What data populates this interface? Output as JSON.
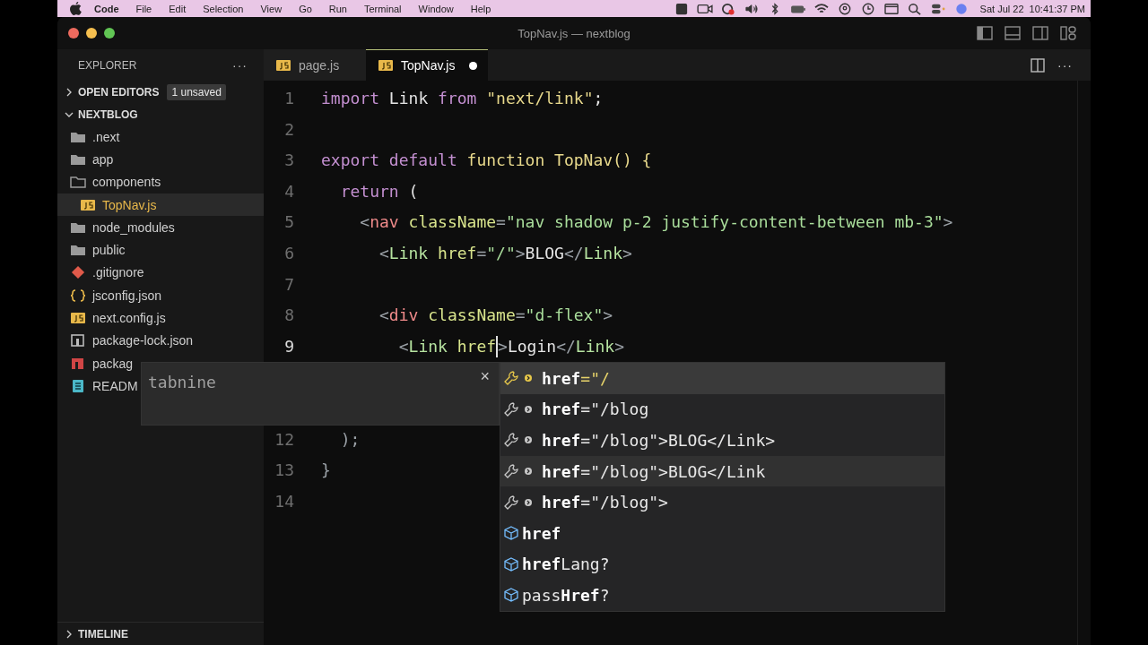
{
  "menubar": {
    "app": "Code",
    "items": [
      "File",
      "Edit",
      "Selection",
      "View",
      "Go",
      "Run",
      "Terminal",
      "Window",
      "Help"
    ],
    "clock": "Sat Jul 22  10:41:37 PM"
  },
  "window": {
    "title": "TopNav.js — nextblog"
  },
  "sidebar": {
    "title": "EXPLORER",
    "more": "···",
    "open_editors": {
      "label": "OPEN EDITORS",
      "expanded": false,
      "badge": "1 unsaved"
    },
    "project": {
      "label": "NEXTBLOG",
      "expanded": true,
      "items": [
        {
          "name": ".next",
          "kind": "folder",
          "expanded": false,
          "selected": false
        },
        {
          "name": "app",
          "kind": "folder",
          "expanded": false,
          "selected": false
        },
        {
          "name": "components",
          "kind": "folder",
          "expanded": true,
          "selected": false,
          "children": [
            {
              "name": "TopNav.js",
              "kind": "js",
              "selected": true
            }
          ]
        },
        {
          "name": "node_modules",
          "kind": "folder",
          "expanded": false,
          "selected": false
        },
        {
          "name": "public",
          "kind": "folder",
          "expanded": false,
          "selected": false
        },
        {
          "name": ".gitignore",
          "kind": "git",
          "selected": false
        },
        {
          "name": "jsconfig.json",
          "kind": "json",
          "selected": false
        },
        {
          "name": "next.config.js",
          "kind": "js",
          "selected": false
        },
        {
          "name": "package-lock.json",
          "kind": "lock",
          "selected": false
        },
        {
          "name": "packag",
          "kind": "pkg",
          "selected": false
        },
        {
          "name": "READM",
          "kind": "readme",
          "selected": false
        }
      ]
    },
    "timeline": {
      "label": "TIMELINE",
      "expanded": false
    }
  },
  "tabs": [
    {
      "label": "page.js",
      "selected": false,
      "dirty": false
    },
    {
      "label": "TopNav.js",
      "selected": true,
      "dirty": true
    }
  ],
  "editor_more": "···",
  "lines": [
    {
      "number": "1",
      "tokens": [
        {
          "kind": "kw",
          "t": "import"
        },
        {
          "kind": "plain",
          "t": " Link "
        },
        {
          "kind": "kw",
          "t": "from"
        },
        {
          "kind": "str",
          "t": " \"next/link\""
        },
        {
          "kind": "plain",
          "t": ";"
        }
      ]
    },
    {
      "number": "2"
    },
    {
      "number": "3",
      "tokens": [
        {
          "kind": "kw",
          "t": "export default"
        },
        {
          "kind": "func",
          "t": " function TopNav() {"
        }
      ]
    },
    {
      "number": "4",
      "tokens": [
        {
          "kind": "kw",
          "t": "  return"
        },
        {
          "kind": "plain",
          "t": " ("
        }
      ]
    },
    {
      "number": "5",
      "tokens": [
        {
          "kind": "punct",
          "t": "    <"
        },
        {
          "kind": "tag",
          "t": "nav"
        },
        {
          "kind": "attr",
          "t": " className"
        },
        {
          "kind": "punct",
          "t": "="
        },
        {
          "kind": "attrstr",
          "t": "\"nav shadow p-2 justify-content-between mb-3\""
        },
        {
          "kind": "punct",
          "t": ">"
        }
      ]
    },
    {
      "number": "6",
      "tokens": [
        {
          "kind": "punct",
          "t": "      <"
        },
        {
          "kind": "comp",
          "t": "Link"
        },
        {
          "kind": "attr",
          "t": " href"
        },
        {
          "kind": "punct",
          "t": "="
        },
        {
          "kind": "attrstr",
          "t": "\"/\""
        },
        {
          "kind": "punct",
          "t": ">"
        },
        {
          "kind": "text",
          "t": "BLOG"
        },
        {
          "kind": "punct",
          "t": "</"
        },
        {
          "kind": "comp",
          "t": "Link"
        },
        {
          "kind": "punct",
          "t": ">"
        }
      ]
    },
    {
      "number": "7"
    },
    {
      "number": "8",
      "tokens": [
        {
          "kind": "punct",
          "t": "      <"
        },
        {
          "kind": "tag",
          "t": "div"
        },
        {
          "kind": "attr",
          "t": " className"
        },
        {
          "kind": "punct",
          "t": "="
        },
        {
          "kind": "attrstr",
          "t": "\"d-flex\""
        },
        {
          "kind": "punct",
          "t": ">"
        }
      ]
    },
    {
      "number": "9",
      "tokens": [
        {
          "kind": "punct",
          "t": "        <"
        },
        {
          "kind": "comp",
          "t": "Link"
        },
        {
          "kind": "attr",
          "t": " href",
          "caret_after": true
        },
        {
          "kind": "punct",
          "t": ">"
        },
        {
          "kind": "text",
          "t": "Login"
        },
        {
          "kind": "punct",
          "t": "</"
        },
        {
          "kind": "comp",
          "t": "Link"
        },
        {
          "kind": "punct",
          "t": ">"
        }
      ]
    },
    {
      "number": "12",
      "tokens": [
        {
          "kind": "punct",
          "t": "  );"
        }
      ]
    },
    {
      "number": "13",
      "tokens": [
        {
          "kind": "punct",
          "t": "}"
        }
      ]
    },
    {
      "number": "14"
    }
  ],
  "hover": {
    "text": "tabnine",
    "close": "×"
  },
  "suggestions": [
    {
      "kind": "snippet",
      "label": "**href**=\"/",
      "selected": true,
      "hovered": false
    },
    {
      "kind": "snippet",
      "label": "**href**=\"/blog",
      "selected": false,
      "hovered": false
    },
    {
      "kind": "snippet",
      "label": "**href**=\"/blog\">BLOG</Link>",
      "selected": false,
      "hovered": false
    },
    {
      "kind": "snippet",
      "label": "**href**=\"/blog\">BLOG</Link",
      "selected": false,
      "hovered": true
    },
    {
      "kind": "snippet",
      "label": "**href**=\"/blog\">",
      "selected": false,
      "hovered": false
    },
    {
      "kind": "property",
      "label": "**href**",
      "selected": false,
      "hovered": false
    },
    {
      "kind": "property",
      "label": "**href**Lang?",
      "selected": false,
      "hovered": false
    },
    {
      "kind": "property",
      "label": "pass**Href**?",
      "selected": false,
      "hovered": false
    }
  ]
}
